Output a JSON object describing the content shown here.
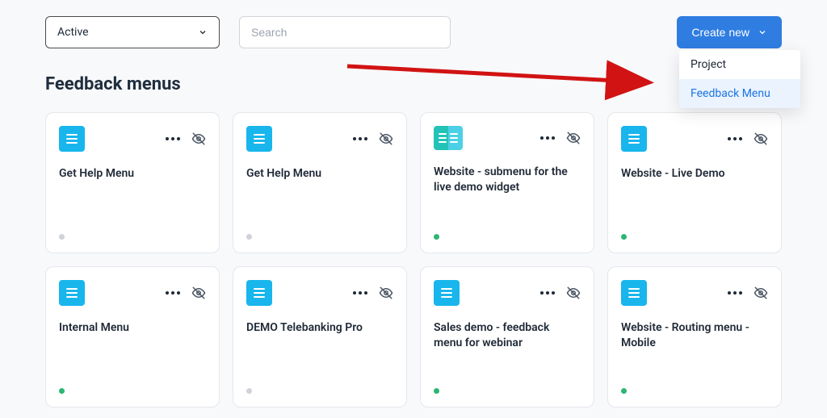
{
  "toolbar": {
    "filter_value": "Active",
    "search_placeholder": "Search",
    "create_label": "Create new"
  },
  "dropdown": {
    "items": [
      {
        "label": "Project",
        "highlight": false
      },
      {
        "label": "Feedback Menu",
        "highlight": true
      }
    ]
  },
  "section_title": "Feedback menus",
  "cards": [
    {
      "title": "Get Help Menu",
      "icon": "menu",
      "status": "gray"
    },
    {
      "title": "Get Help Menu",
      "icon": "menu",
      "status": "gray"
    },
    {
      "title": "Website - submenu for the live demo widget",
      "icon": "menu-alt",
      "status": "green"
    },
    {
      "title": "Website - Live Demo",
      "icon": "menu",
      "status": "green"
    },
    {
      "title": "Internal Menu",
      "icon": "menu",
      "status": "green"
    },
    {
      "title": "DEMO Telebanking Pro",
      "icon": "menu",
      "status": "gray"
    },
    {
      "title": "Sales demo - feedback menu for webinar",
      "icon": "menu",
      "status": "green"
    },
    {
      "title": "Website - Routing menu - Mobile",
      "icon": "menu",
      "status": "green"
    }
  ]
}
